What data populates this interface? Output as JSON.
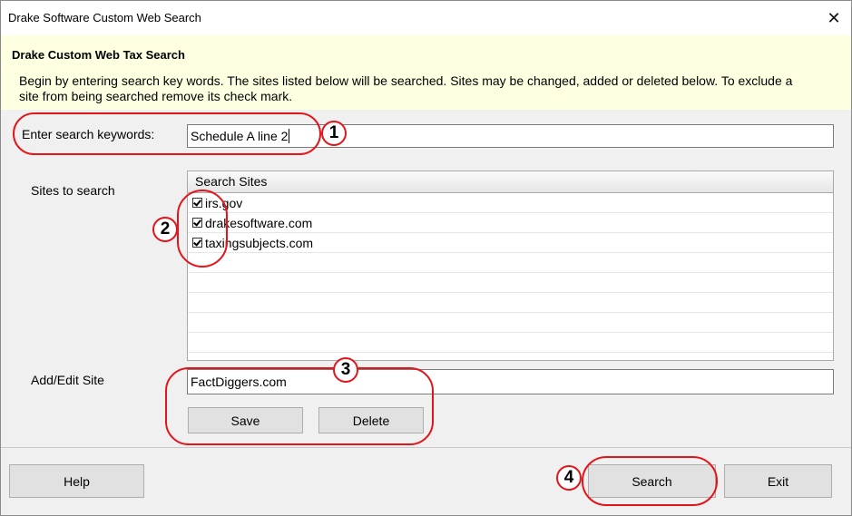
{
  "window": {
    "title": "Drake Software Custom Web Search",
    "close_glyph": "✕"
  },
  "banner": {
    "heading": "Drake Custom Web Tax Search",
    "description": "Begin by entering search key words. The sites listed below will be searched. Sites may be changed, added or deleted below. To exclude a site from being searched remove its check mark."
  },
  "keywords": {
    "label": "Enter search keywords:",
    "value": "Schedule A line 2"
  },
  "sites": {
    "label": "Sites to search",
    "column_header": "Search Sites",
    "items": [
      {
        "name": "irs.gov",
        "checked": true
      },
      {
        "name": "drakesoftware.com",
        "checked": true
      },
      {
        "name": "taxingsubjects.com",
        "checked": true
      }
    ]
  },
  "add_edit": {
    "label": "Add/Edit Site",
    "value": "FactDiggers.com",
    "save_label": "Save",
    "delete_label": "Delete"
  },
  "footer": {
    "help_label": "Help",
    "search_label": "Search",
    "exit_label": "Exit"
  },
  "annotations": {
    "color": "#e3151a",
    "markers": [
      "1",
      "2",
      "3",
      "4"
    ]
  }
}
